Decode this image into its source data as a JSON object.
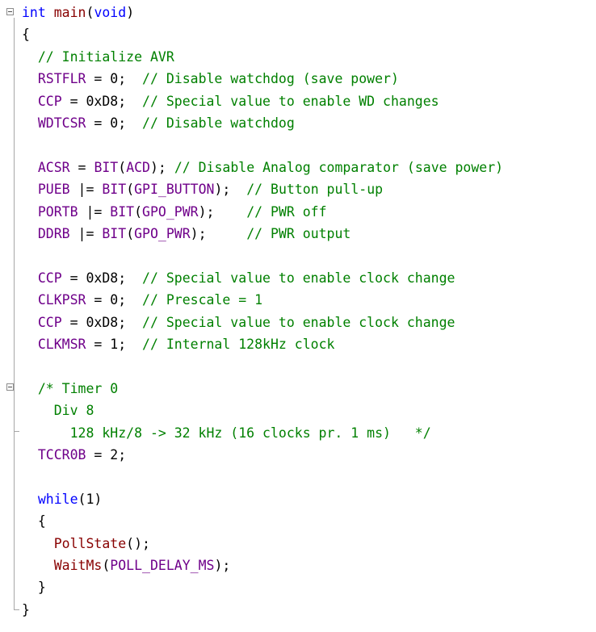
{
  "colors": {
    "keyword": "#0000ff",
    "function": "#880000",
    "macro": "#6f008a",
    "comment": "#008000",
    "plain": "#000000"
  },
  "icons": [
    "fold-collapse-icon"
  ],
  "lines": [
    [
      [
        "kw",
        "int"
      ],
      [
        "pl",
        " "
      ],
      [
        "fn",
        "main"
      ],
      [
        "pl",
        "("
      ],
      [
        "kw",
        "void"
      ],
      [
        "pl",
        ")"
      ]
    ],
    [
      [
        "pl",
        "{"
      ]
    ],
    [
      [
        "pl",
        "  "
      ],
      [
        "cm",
        "// Initialize AVR"
      ]
    ],
    [
      [
        "pl",
        "  "
      ],
      [
        "macro",
        "RSTFLR"
      ],
      [
        "pl",
        " = 0;  "
      ],
      [
        "cm",
        "// Disable watchdog (save power)"
      ]
    ],
    [
      [
        "pl",
        "  "
      ],
      [
        "macro",
        "CCP"
      ],
      [
        "pl",
        " = 0xD8;  "
      ],
      [
        "cm",
        "// Special value to enable WD changes"
      ]
    ],
    [
      [
        "pl",
        "  "
      ],
      [
        "macro",
        "WDTCSR"
      ],
      [
        "pl",
        " = 0;  "
      ],
      [
        "cm",
        "// Disable watchdog"
      ]
    ],
    [],
    [
      [
        "pl",
        "  "
      ],
      [
        "macro",
        "ACSR"
      ],
      [
        "pl",
        " = "
      ],
      [
        "macro",
        "BIT"
      ],
      [
        "pl",
        "("
      ],
      [
        "macro",
        "ACD"
      ],
      [
        "pl",
        "); "
      ],
      [
        "cm",
        "// Disable Analog comparator (save power)"
      ]
    ],
    [
      [
        "pl",
        "  "
      ],
      [
        "macro",
        "PUEB"
      ],
      [
        "pl",
        " |= "
      ],
      [
        "macro",
        "BIT"
      ],
      [
        "pl",
        "("
      ],
      [
        "macro",
        "GPI_BUTTON"
      ],
      [
        "pl",
        ");  "
      ],
      [
        "cm",
        "// Button pull-up"
      ]
    ],
    [
      [
        "pl",
        "  "
      ],
      [
        "macro",
        "PORTB"
      ],
      [
        "pl",
        " |= "
      ],
      [
        "macro",
        "BIT"
      ],
      [
        "pl",
        "("
      ],
      [
        "macro",
        "GPO_PWR"
      ],
      [
        "pl",
        ");    "
      ],
      [
        "cm",
        "// PWR off"
      ]
    ],
    [
      [
        "pl",
        "  "
      ],
      [
        "macro",
        "DDRB"
      ],
      [
        "pl",
        " |= "
      ],
      [
        "macro",
        "BIT"
      ],
      [
        "pl",
        "("
      ],
      [
        "macro",
        "GPO_PWR"
      ],
      [
        "pl",
        ");     "
      ],
      [
        "cm",
        "// PWR output"
      ]
    ],
    [],
    [
      [
        "pl",
        "  "
      ],
      [
        "macro",
        "CCP"
      ],
      [
        "pl",
        " = 0xD8;  "
      ],
      [
        "cm",
        "// Special value to enable clock change"
      ]
    ],
    [
      [
        "pl",
        "  "
      ],
      [
        "macro",
        "CLKPSR"
      ],
      [
        "pl",
        " = 0;  "
      ],
      [
        "cm",
        "// Prescale = 1"
      ]
    ],
    [
      [
        "pl",
        "  "
      ],
      [
        "macro",
        "CCP"
      ],
      [
        "pl",
        " = 0xD8;  "
      ],
      [
        "cm",
        "// Special value to enable clock change"
      ]
    ],
    [
      [
        "pl",
        "  "
      ],
      [
        "macro",
        "CLKMSR"
      ],
      [
        "pl",
        " = 1;  "
      ],
      [
        "cm",
        "// Internal 128kHz clock"
      ]
    ],
    [],
    [
      [
        "pl",
        "  "
      ],
      [
        "cm",
        "/* Timer 0"
      ]
    ],
    [
      [
        "pl",
        "  "
      ],
      [
        "cm",
        "  Div 8"
      ]
    ],
    [
      [
        "pl",
        "  "
      ],
      [
        "cm",
        "    128 kHz/8 -> 32 kHz (16 clocks pr. 1 ms)   */"
      ]
    ],
    [
      [
        "pl",
        "  "
      ],
      [
        "macro",
        "TCCR0B"
      ],
      [
        "pl",
        " = 2;"
      ]
    ],
    [],
    [
      [
        "pl",
        "  "
      ],
      [
        "kw",
        "while"
      ],
      [
        "pl",
        "(1)"
      ]
    ],
    [
      [
        "pl",
        "  {"
      ]
    ],
    [
      [
        "pl",
        "    "
      ],
      [
        "fn",
        "PollState"
      ],
      [
        "pl",
        "();"
      ]
    ],
    [
      [
        "pl",
        "    "
      ],
      [
        "fn",
        "WaitMs"
      ],
      [
        "pl",
        "("
      ],
      [
        "macro",
        "POLL_DELAY_MS"
      ],
      [
        "pl",
        ");"
      ]
    ],
    [
      [
        "pl",
        "  }"
      ]
    ],
    [
      [
        "pl",
        "}"
      ]
    ]
  ]
}
